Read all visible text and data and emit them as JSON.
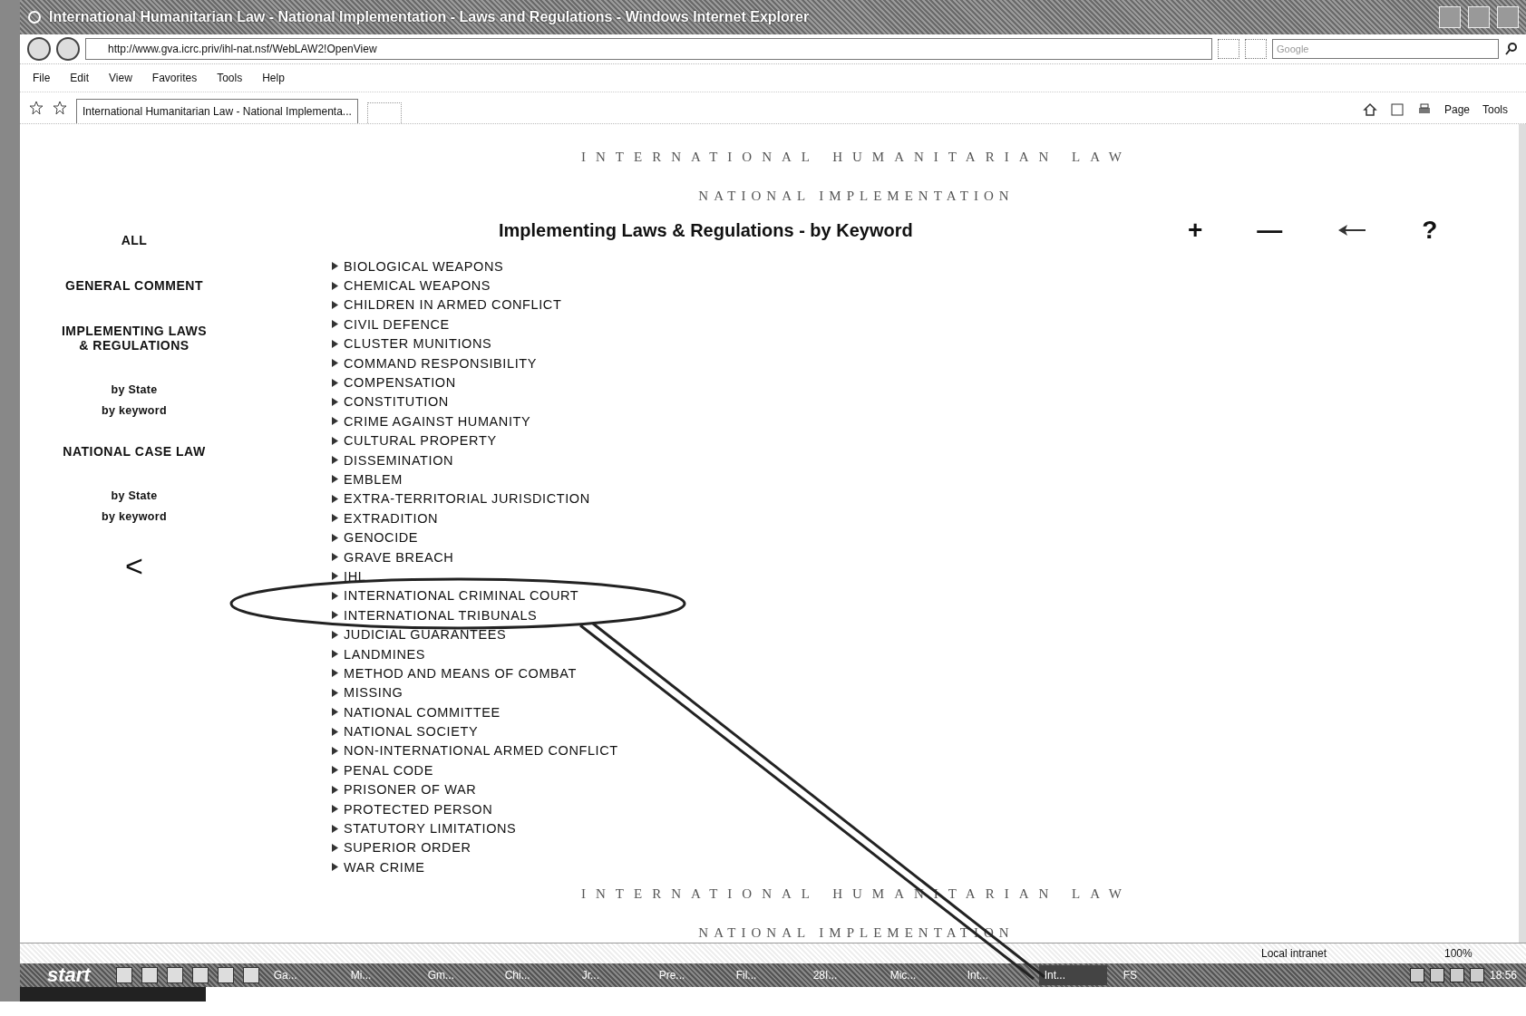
{
  "window": {
    "title": "International Humanitarian Law - National Implementation - Laws and Regulations - Windows Internet Explorer"
  },
  "address_bar": {
    "url": "http://www.gva.icrc.priv/ihl-nat.nsf/WebLAW2!OpenView"
  },
  "search": {
    "placeholder": "Google"
  },
  "menu": [
    "File",
    "Edit",
    "View",
    "Favorites",
    "Tools",
    "Help"
  ],
  "tab": {
    "title": "International Humanitarian Law - National Implementa..."
  },
  "command_bar": [
    "Page",
    "Tools"
  ],
  "page": {
    "header_lines": [
      "INTERNATIONAL HUMANITARIAN LAW",
      "NATIONAL IMPLEMENTATION"
    ],
    "heading": "Implementing Laws & Regulations - by Keyword",
    "tools": [
      {
        "kind": "text",
        "label": "+"
      },
      {
        "kind": "text",
        "label": "—"
      },
      {
        "kind": "arrow"
      },
      {
        "kind": "text",
        "label": "?"
      }
    ],
    "sidebar": [
      {
        "kind": "heading",
        "label": "ALL"
      },
      {
        "kind": "heading",
        "label": "GENERAL COMMENT"
      },
      {
        "kind": "heading",
        "label": "IMPLEMENTING LAWS & REGULATIONS"
      },
      {
        "kind": "link",
        "label": "by State"
      },
      {
        "kind": "link",
        "label": "by keyword"
      },
      {
        "kind": "heading",
        "label": "NATIONAL CASE LAW"
      },
      {
        "kind": "link",
        "label": "by State"
      },
      {
        "kind": "link",
        "label": "by keyword"
      },
      {
        "kind": "back",
        "label": "<"
      }
    ],
    "keywords": [
      "BIOLOGICAL WEAPONS",
      "CHEMICAL WEAPONS",
      "CHILDREN IN ARMED CONFLICT",
      "CIVIL DEFENCE",
      "CLUSTER MUNITIONS",
      "COMMAND RESPONSIBILITY",
      "COMPENSATION",
      "CONSTITUTION",
      "CRIME AGAINST HUMANITY",
      "CULTURAL PROPERTY",
      "DISSEMINATION",
      "EMBLEM",
      "EXTRA-TERRITORIAL JURISDICTION",
      "EXTRADITION",
      "GENOCIDE",
      "GRAVE BREACH",
      "IHL",
      "INTERNATIONAL CRIMINAL COURT",
      "INTERNATIONAL TRIBUNALS",
      "JUDICIAL GUARANTEES",
      "LANDMINES",
      "METHOD AND MEANS OF COMBAT",
      "MISSING",
      "NATIONAL COMMITTEE",
      "NATIONAL SOCIETY",
      "NON-INTERNATIONAL ARMED CONFLICT",
      "PENAL CODE",
      "PRISONER OF WAR",
      "PROTECTED PERSON",
      "STATUTORY LIMITATIONS",
      "SUPERIOR ORDER",
      "WAR CRIME"
    ],
    "footer_lines": [
      "INTERNATIONAL HUMANITARIAN LAW",
      "NATIONAL IMPLEMENTATION"
    ]
  },
  "status_bar": {
    "zone": "Local intranet",
    "zoom": "100%"
  },
  "taskbar": {
    "start": "start",
    "tasks": [
      {
        "label": "Ga...",
        "selected": false
      },
      {
        "label": "Mi...",
        "selected": false
      },
      {
        "label": "Gm...",
        "selected": false
      },
      {
        "label": "Chi...",
        "selected": false
      },
      {
        "label": "Jr...",
        "selected": false
      },
      {
        "label": "Pre...",
        "selected": false
      },
      {
        "label": "Fil...",
        "selected": false
      },
      {
        "label": "28I...",
        "selected": false
      },
      {
        "label": "Mic...",
        "selected": false
      },
      {
        "label": "Int...",
        "selected": false
      },
      {
        "label": "Int...",
        "selected": true
      }
    ],
    "language": "FS",
    "clock": "18:56"
  }
}
